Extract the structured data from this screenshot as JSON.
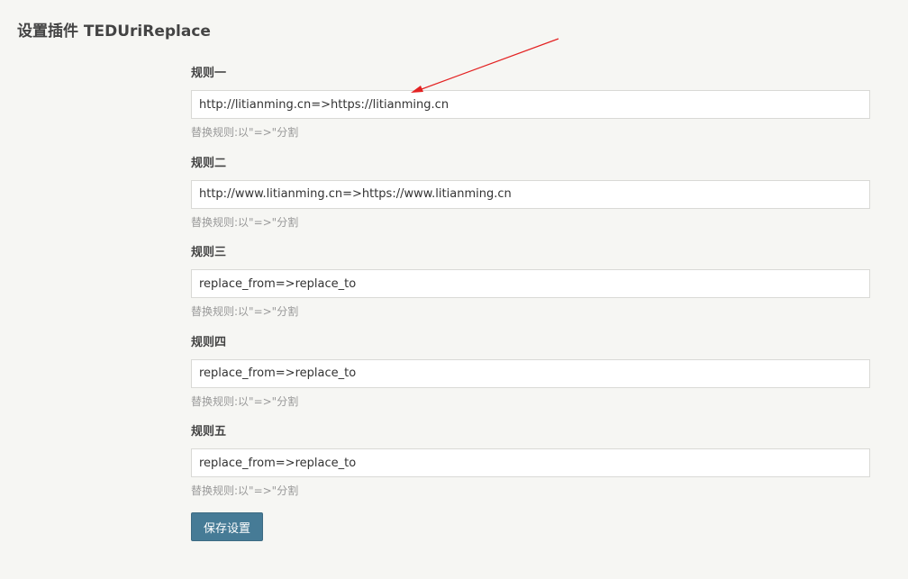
{
  "page": {
    "title": "设置插件 TEDUriReplace"
  },
  "rules": [
    {
      "label": "规则一",
      "value": "http://litianming.cn=>https://litianming.cn",
      "hint": "替换规则:以\"=>\"分割"
    },
    {
      "label": "规则二",
      "value": "http://www.litianming.cn=>https://www.litianming.cn",
      "hint": "替换规则:以\"=>\"分割"
    },
    {
      "label": "规则三",
      "value": "replace_from=>replace_to",
      "hint": "替换规则:以\"=>\"分割"
    },
    {
      "label": "规则四",
      "value": "replace_from=>replace_to",
      "hint": "替换规则:以\"=>\"分割"
    },
    {
      "label": "规则五",
      "value": "replace_from=>replace_to",
      "hint": "替换规则:以\"=>\"分割"
    }
  ],
  "save_button": {
    "label": "保存设置"
  },
  "colors": {
    "background": "#f6f6f3",
    "primary_button": "#467b96",
    "annotation_arrow": "#e32222"
  }
}
